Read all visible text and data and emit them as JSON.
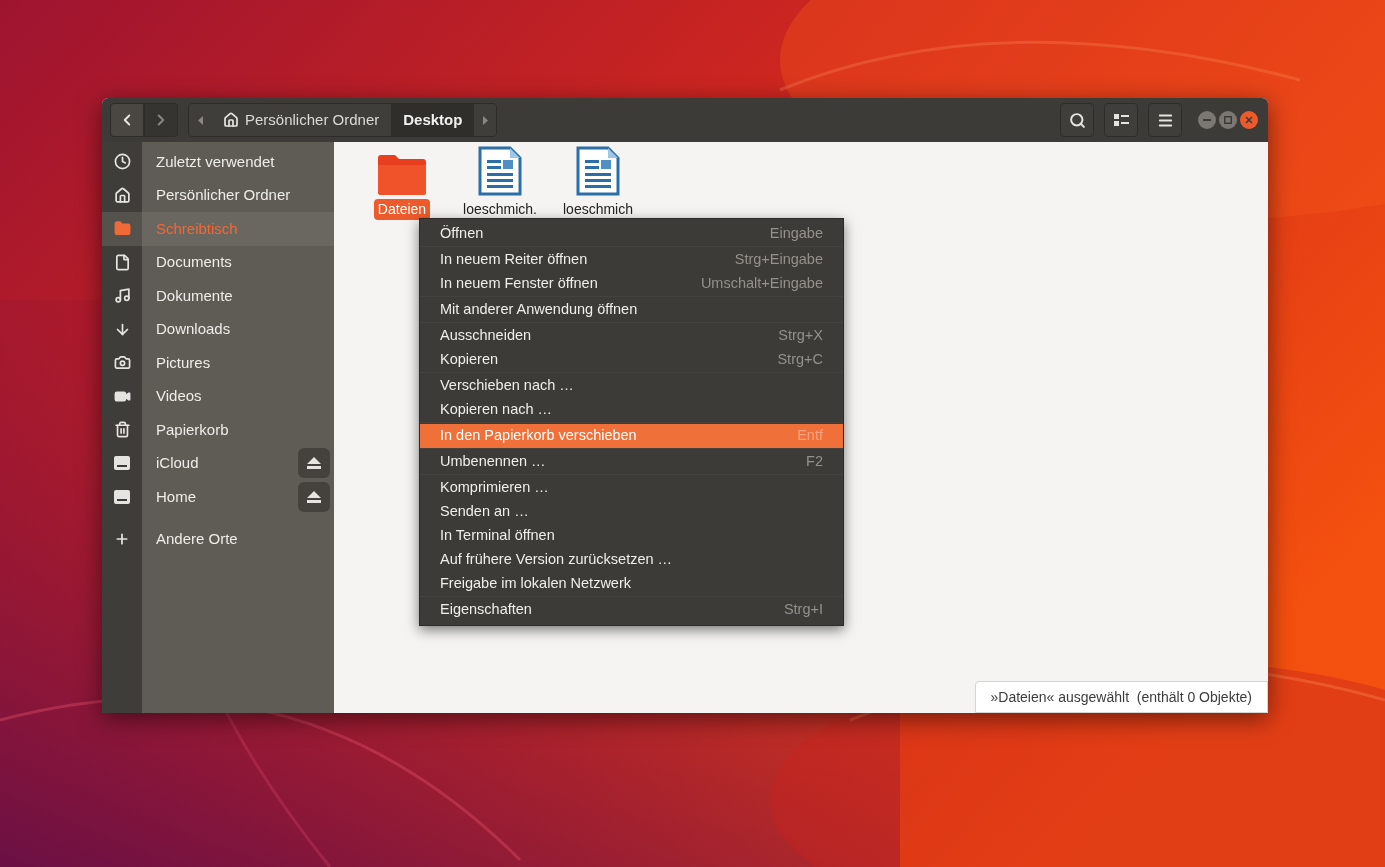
{
  "navigation": [
    {
      "kind": "back",
      "disabled": false
    },
    {
      "kind": "forward",
      "disabled": true
    }
  ],
  "breadcrumbs": [
    {
      "label": "Persönlicher Ordner",
      "kind": "home",
      "selected": false
    },
    {
      "label": "Desktop",
      "kind": "folder",
      "selected": true
    }
  ],
  "sidebar": {
    "items": [
      {
        "label": "Zuletzt verwendet",
        "kind": "recent",
        "selected": false,
        "ejectable": false
      },
      {
        "label": "Persönlicher Ordner",
        "kind": "home",
        "selected": false,
        "ejectable": false
      },
      {
        "label": "Schreibtisch",
        "kind": "desktop",
        "selected": true,
        "ejectable": false
      },
      {
        "label": "Documents",
        "kind": "document",
        "selected": false,
        "ejectable": false
      },
      {
        "label": "Dokumente",
        "kind": "music",
        "selected": false,
        "ejectable": false
      },
      {
        "label": "Downloads",
        "kind": "download",
        "selected": false,
        "ejectable": false
      },
      {
        "label": "Pictures",
        "kind": "camera",
        "selected": false,
        "ejectable": false
      },
      {
        "label": "Videos",
        "kind": "video",
        "selected": false,
        "ejectable": false
      },
      {
        "label": "Papierkorb",
        "kind": "trash",
        "selected": false,
        "ejectable": false
      },
      {
        "label": "iCloud",
        "kind": "drive",
        "selected": false,
        "ejectable": true
      },
      {
        "label": "Home",
        "kind": "drive",
        "selected": false,
        "ejectable": true
      }
    ],
    "other": {
      "label": "Andere Orte"
    }
  },
  "files": [
    {
      "name": "Dateien",
      "kind": "folder",
      "selected": true
    },
    {
      "name": "loeschmich.",
      "kind": "document",
      "selected": false
    },
    {
      "name": "loeschmich",
      "kind": "document",
      "selected": false
    }
  ],
  "context_menu": {
    "groups": [
      [
        {
          "label": "Öffnen",
          "shortcut": "Eingabe",
          "selected": false
        }
      ],
      [
        {
          "label": "In neuem Reiter öffnen",
          "shortcut": "Strg+Eingabe",
          "selected": false
        },
        {
          "label": "In neuem Fenster öffnen",
          "shortcut": "Umschalt+Eingabe",
          "selected": false
        }
      ],
      [
        {
          "label": "Mit anderer Anwendung öffnen",
          "selected": false
        }
      ],
      [
        {
          "label": "Ausschneiden",
          "shortcut": "Strg+X",
          "selected": false
        },
        {
          "label": "Kopieren",
          "shortcut": "Strg+C",
          "selected": false
        }
      ],
      [
        {
          "label": "Verschieben nach …",
          "selected": false
        },
        {
          "label": "Kopieren nach …",
          "selected": false
        }
      ],
      [
        {
          "label": "In den Papierkorb verschieben",
          "shortcut": "Entf",
          "selected": true
        }
      ],
      [
        {
          "label": "Umbenennen …",
          "shortcut": "F2",
          "selected": false
        }
      ],
      [
        {
          "label": "Komprimieren …",
          "selected": false
        },
        {
          "label": "Senden an …",
          "selected": false
        },
        {
          "label": "In Terminal öffnen",
          "selected": false
        },
        {
          "label": "Auf frühere Version zurücksetzen …",
          "selected": false
        },
        {
          "label": "Freigabe im lokalen Netzwerk",
          "selected": false
        }
      ],
      [
        {
          "label": "Eigenschaften",
          "shortcut": "Strg+I",
          "selected": false
        }
      ]
    ]
  },
  "status_bar": {
    "text": "»Dateien« ausgewählt  (enthält 0 Objekte)"
  }
}
